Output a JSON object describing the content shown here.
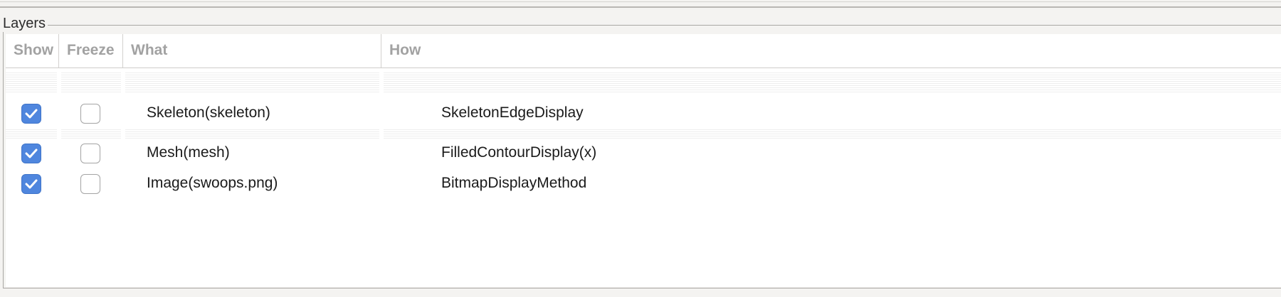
{
  "panel": {
    "title": "Layers"
  },
  "columns": [
    {
      "label": "Show"
    },
    {
      "label": "Freeze"
    },
    {
      "label": "What"
    },
    {
      "label": "How"
    }
  ],
  "rows": [
    {
      "show": true,
      "freeze": false,
      "what": "Skeleton(skeleton)",
      "how": "SkeletonEdgeDisplay"
    },
    {
      "show": true,
      "freeze": false,
      "what": "Mesh(mesh)",
      "how": "FilledContourDisplay(x)"
    },
    {
      "show": true,
      "freeze": false,
      "what": "Image(swoops.png)",
      "how": "BitmapDisplayMethod"
    }
  ],
  "icons": {
    "checked": "checkmark-icon"
  },
  "colors": {
    "checkbox_checked": "#4f86de",
    "header_text": "#a2a2a2"
  }
}
